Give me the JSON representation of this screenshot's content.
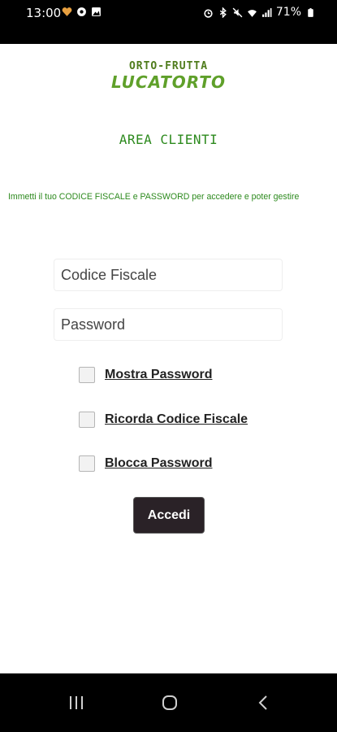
{
  "status_bar": {
    "time": "13:00",
    "battery": "71%",
    "left_icons": [
      "heart-icon",
      "circle-icon",
      "image-icon"
    ],
    "right_icons": [
      "alarm-icon",
      "bluetooth-icon",
      "mute-icon",
      "wifi-icon",
      "signal-icon",
      "battery-icon"
    ]
  },
  "logo": {
    "top": "ORTO-FRUTTA",
    "main": "LUCATORTO"
  },
  "area_title": "AREA CLIENTI",
  "instructions": "Immetti il tuo CODICE FISCALE e PASSWORD per accedere e poter gestire",
  "form": {
    "codice_fiscale_placeholder": "Codice Fiscale",
    "codice_fiscale_value": "",
    "password_placeholder": "Password",
    "password_value": "",
    "checkboxes": [
      {
        "label": "Mostra Password",
        "checked": false
      },
      {
        "label": "Ricorda Codice Fiscale",
        "checked": false
      },
      {
        "label": "Blocca Password",
        "checked": false
      }
    ],
    "submit_label": "Accedi"
  },
  "nav": [
    "recent-apps-icon",
    "home-icon",
    "back-icon"
  ],
  "colors": {
    "title_green": "#2d8a1e",
    "logo_green": "#5fa02a",
    "button_bg": "#2a2227"
  }
}
